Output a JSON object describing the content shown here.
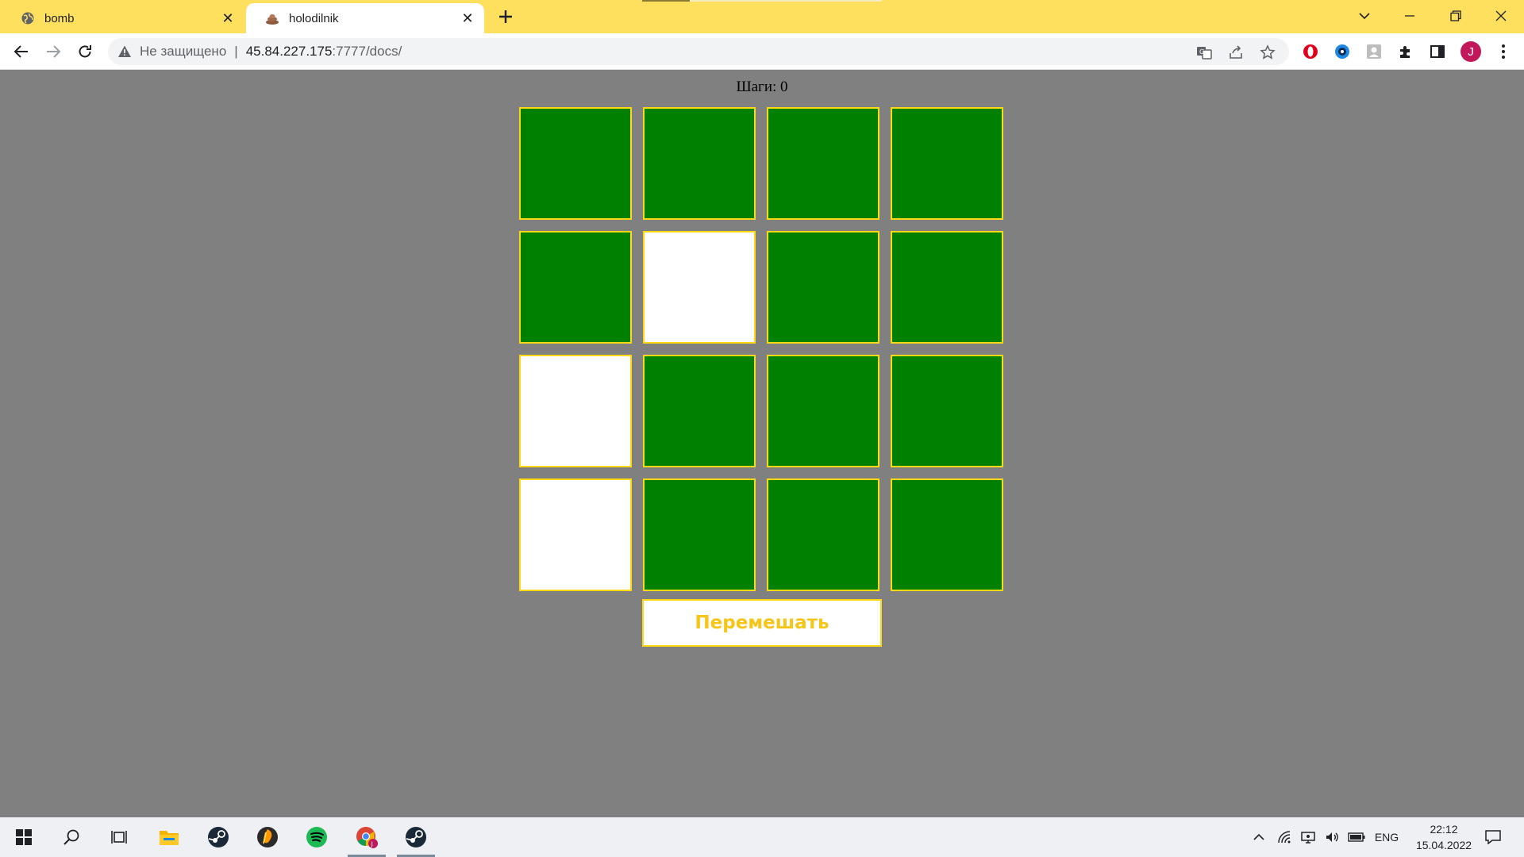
{
  "browser": {
    "tabs": [
      {
        "title": "bomb",
        "favicon": "globe-icon",
        "active": false
      },
      {
        "title": "holodilnik",
        "favicon": "pile-icon",
        "active": true
      }
    ],
    "address": {
      "security_label": "Не защищено",
      "host": "45.84.227.175",
      "path": ":7777/docs/"
    },
    "avatar_letter": "J"
  },
  "game": {
    "steps_label": "Шаги: 0",
    "grid": [
      [
        "green",
        "green",
        "green",
        "green"
      ],
      [
        "green",
        "white",
        "green",
        "green"
      ],
      [
        "white",
        "green",
        "green",
        "green"
      ],
      [
        "white",
        "green",
        "green",
        "green"
      ]
    ],
    "shuffle_label": "Перемешать",
    "colors": {
      "on": "#008000",
      "off": "#ffffff",
      "border": "#ffd814",
      "background": "#808080"
    }
  },
  "taskbar": {
    "apps": [
      "windows-start-icon",
      "search-icon",
      "task-view-icon",
      "file-explorer-icon",
      "steam-icon",
      "fl-studio-icon",
      "spotify-icon",
      "chrome-icon",
      "steam-icon"
    ],
    "language": "ENG",
    "time": "22:12",
    "date": "15.04.2022"
  }
}
